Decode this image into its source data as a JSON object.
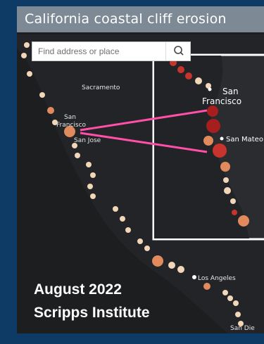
{
  "title": "California coastal cliff erosion",
  "search": {
    "placeholder": "Find address or place"
  },
  "labels": {
    "sacramento": "Sacramento",
    "san_francisco_line1": "San",
    "san_francisco_line2": "Francisco",
    "san_jose": "San Jose",
    "los_angeles": "Los Angeles",
    "san_diego": "San Die",
    "inset_san_francisco_line1": "San",
    "inset_san_francisco_line2": "Francisco",
    "inset_san_mateo": "San Mateo"
  },
  "caption": {
    "line1": "August 2022",
    "line2": "Scripps Institute"
  },
  "colors": {
    "frame": "#0e3a66",
    "map_bg": "#1d1e20",
    "title_bar": "#7d8a95",
    "callout_line": "#ff4fa8",
    "marker_light": "#f1d6b8",
    "marker_orange": "#e08a5e",
    "marker_red": "#c7342d",
    "marker_dark_red": "#a61e1e"
  }
}
